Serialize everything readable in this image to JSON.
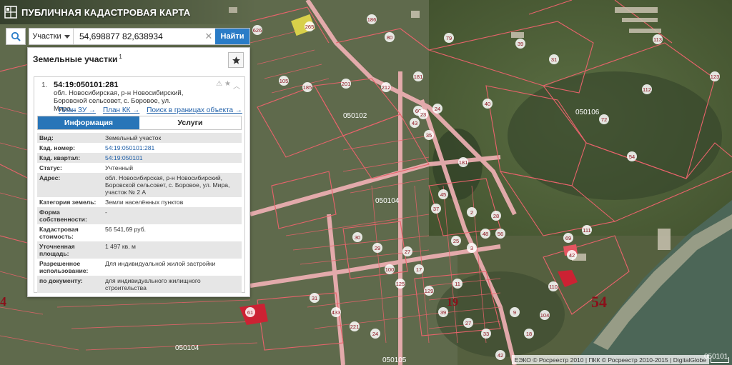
{
  "app": {
    "title": "ПУБЛИЧНАЯ КАДАСТРОВАЯ КАРТА"
  },
  "search": {
    "type_label": "Участки",
    "value": "54,698877 82,638934",
    "button_label": "Найти"
  },
  "panel": {
    "title": "Земельные участки",
    "count": "1",
    "card": {
      "index": "1.",
      "number": "54:19:050101:281",
      "address_line1": "обл. Новосибирская, р-н Новосибирский,",
      "address_line2": "Боровской сельсовет, с. Боровое, ул. Мира...",
      "links": [
        "План ЗУ →",
        "План КК →",
        "Поиск в границах объекта →"
      ],
      "tabs": [
        "Информация",
        "Услуги"
      ],
      "rows": [
        {
          "key": "Вид:",
          "value": "Земельный участок"
        },
        {
          "key": "Кад. номер:",
          "value": "54:19:050101:281"
        },
        {
          "key": "Кад. квартал:",
          "value": "54:19:050101"
        },
        {
          "key": "Статус:",
          "value": "Учтенный"
        },
        {
          "key": "Адрес:",
          "value": "обл. Новосибирская, р-н Новосибирский, Боровской сельсовет, с. Боровое, ул. Мира, участок № 2 А"
        },
        {
          "key": "Категория земель:",
          "value": "Земли населённых пунктов"
        },
        {
          "key": "Форма собственности:",
          "value": "-"
        },
        {
          "key": "Кадастровая стоимость:",
          "value": "56 541,69 руб."
        },
        {
          "key": "Уточненная площадь:",
          "value": "1 497 кв. м"
        },
        {
          "key": "Разрешенное использование:",
          "value": "Для индивидуальной жилой застройки"
        },
        {
          "key": "по документу:",
          "value": "для индивидуального жилищного строительства"
        }
      ]
    }
  },
  "map": {
    "quarter_labels": [
      {
        "id": "q1",
        "text": "050102"
      },
      {
        "id": "q2",
        "text": "050106"
      },
      {
        "id": "q3",
        "text": "050104"
      },
      {
        "id": "q4",
        "text": "050105"
      },
      {
        "id": "q5",
        "text": "050104"
      },
      {
        "id": "q6",
        "text": "050101"
      }
    ],
    "big_labels": [
      {
        "id": "b1",
        "text": "54"
      },
      {
        "id": "b2",
        "text": "19"
      },
      {
        "id": "b3",
        "text": "4"
      }
    ],
    "parcel_labels": [
      "626",
      "186",
      "80",
      "79",
      "39",
      "31",
      "113",
      "123",
      "112",
      "40",
      "72",
      "54",
      "265",
      "105",
      "185",
      "201",
      "212",
      "181",
      "24",
      "43",
      "35",
      "181",
      "28",
      "42",
      "110",
      "111",
      "69",
      "60",
      "23",
      "25",
      "27",
      "30",
      "29",
      "100",
      "17",
      "61",
      "31",
      "433",
      "221",
      "24",
      "125",
      "129",
      "39",
      "27",
      "33",
      "42",
      "9",
      "18",
      "104",
      "3",
      "2",
      "48",
      "56",
      "37",
      "45",
      "11"
    ]
  },
  "footer": {
    "attribution": "ЕЭКО © Росреестр 2010 | ПКК © Росреестр 2010-2015 | DigitalGlobe"
  },
  "colors": {
    "accent": "#2875b8",
    "parcel_line": "#e8636b",
    "road": "#f4b5b8",
    "water": "#4e6a5a"
  }
}
